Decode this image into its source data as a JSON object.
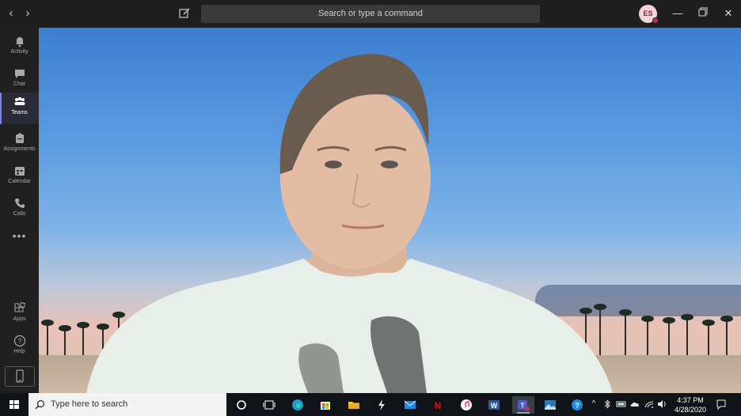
{
  "titlebar": {
    "search_placeholder": "Search or type a command",
    "avatar_initials": "ES"
  },
  "rail": {
    "items": [
      {
        "label": "Activity",
        "icon": "bell-icon"
      },
      {
        "label": "Chat",
        "icon": "chat-icon"
      },
      {
        "label": "Teams",
        "icon": "teams-icon"
      },
      {
        "label": "Assignments",
        "icon": "assignments-icon"
      },
      {
        "label": "Calendar",
        "icon": "calendar-icon"
      },
      {
        "label": "Calls",
        "icon": "phone-icon"
      }
    ],
    "more": "•••",
    "bottom": [
      {
        "label": "Apps",
        "icon": "apps-icon"
      },
      {
        "label": "Help",
        "icon": "help-icon"
      }
    ],
    "active_index": 2
  },
  "taskbar": {
    "search_placeholder": "Type here to search",
    "time": "4:37 PM",
    "date": "4/28/2020"
  },
  "colors": {
    "teams_accent": "#7b83eb",
    "titlebar_bg": "#1f1f1f",
    "rail_bg": "#202020",
    "presence_busy": "#c4314b"
  }
}
